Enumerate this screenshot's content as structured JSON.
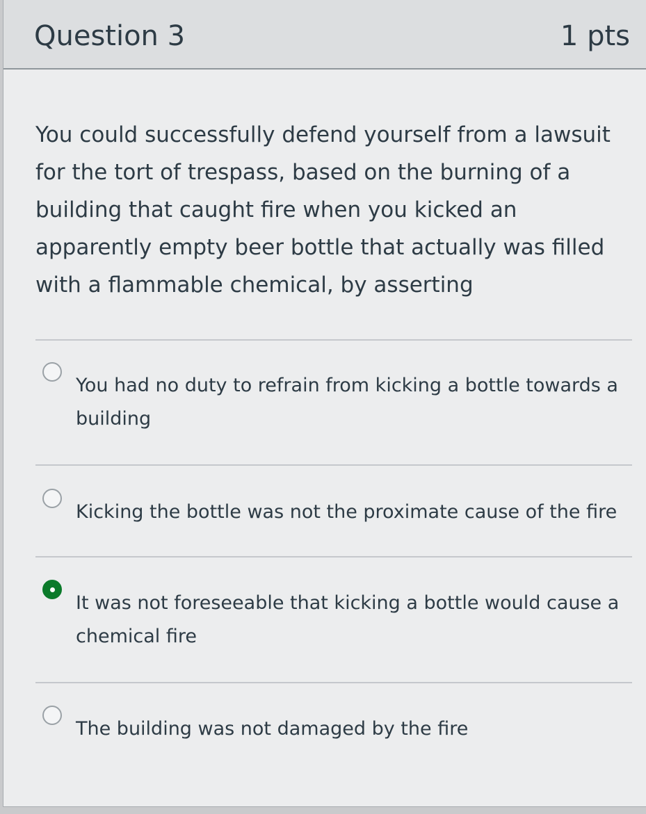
{
  "question": {
    "title": "Question 3",
    "points": "1 pts",
    "text": "You could successfully defend yourself from a lawsuit for the tort of trespass, based on the burning of a building that caught fire when you kicked an apparently empty beer bottle that actually was filled with a flammable chemical, by asserting"
  },
  "answers": [
    {
      "label": "You had no duty to refrain from kicking a bottle towards a building",
      "selected": false
    },
    {
      "label": "Kicking the bottle was not the proximate cause of the fire",
      "selected": false
    },
    {
      "label": "It was not foreseeable that kicking a bottle would cause a chemical fire",
      "selected": true
    },
    {
      "label": "The building was not damaged by the fire",
      "selected": false
    }
  ],
  "colors": {
    "selected_radio": "#0b7a2a",
    "header_background": "#dcdee0",
    "text": "#2d3b45"
  }
}
